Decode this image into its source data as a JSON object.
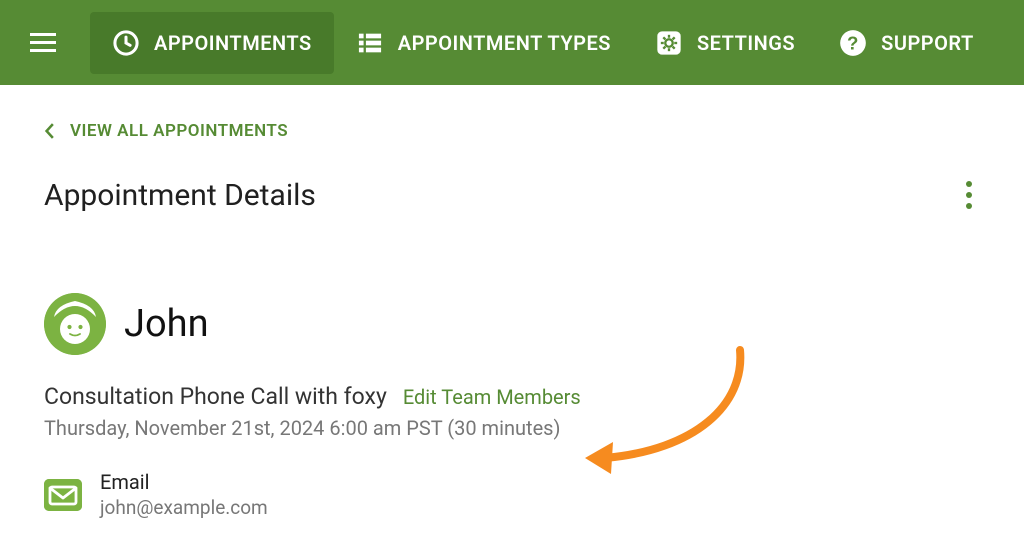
{
  "nav": {
    "items": [
      {
        "label": "APPOINTMENTS",
        "icon": "clock"
      },
      {
        "label": "APPOINTMENT TYPES",
        "icon": "list"
      },
      {
        "label": "SETTINGS",
        "icon": "gear"
      },
      {
        "label": "SUPPORT",
        "icon": "help"
      }
    ]
  },
  "breadcrumb": {
    "label": "VIEW ALL APPOINTMENTS"
  },
  "page": {
    "title": "Appointment Details"
  },
  "appointment": {
    "attendee_name": "John",
    "event_title": "Consultation Phone Call with foxy",
    "edit_team_link": "Edit Team Members",
    "datetime_text": "Thursday, November 21st, 2024 6:00 am PST (30 minutes)",
    "contact": {
      "label": "Email",
      "value": "john@example.com"
    }
  },
  "colors": {
    "brand_green": "#568b34",
    "avatar_green": "#7cb342",
    "annotation_orange": "#f68b1f"
  }
}
